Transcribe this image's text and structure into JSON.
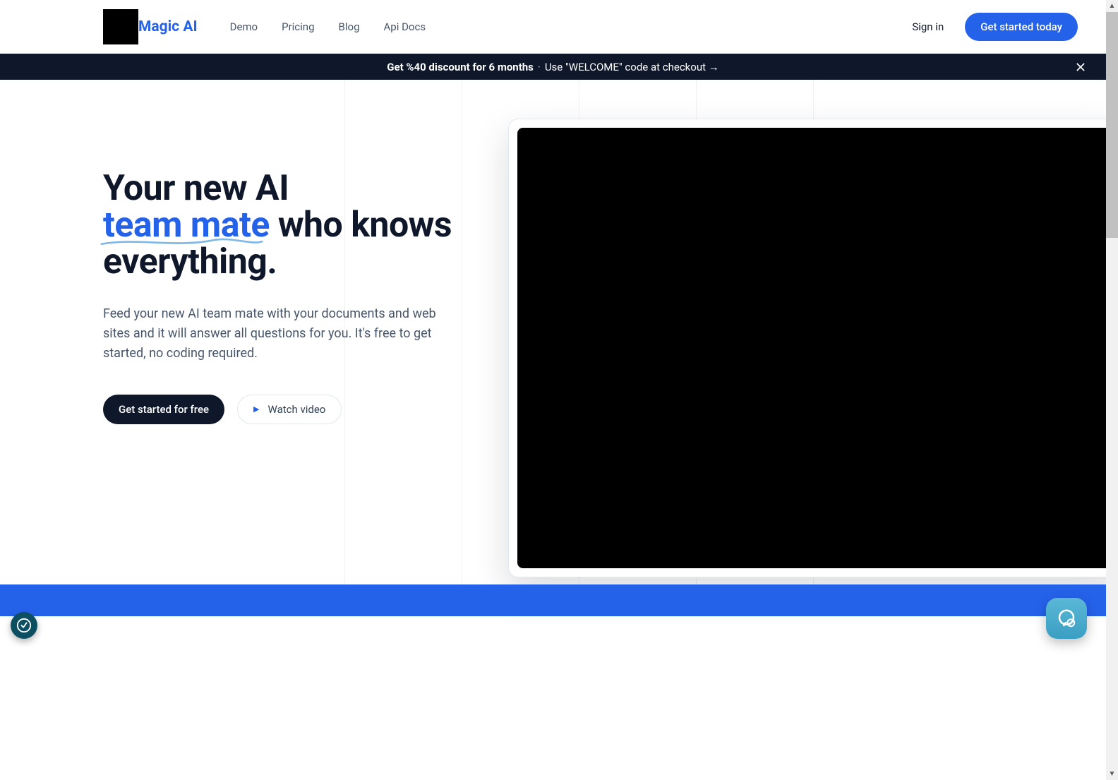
{
  "brand": "Magic AI",
  "nav": {
    "items": [
      "Demo",
      "Pricing",
      "Blog",
      "Api Docs"
    ],
    "signin": "Sign in",
    "cta": "Get started today"
  },
  "promo": {
    "bold": "Get %40 discount for 6 months",
    "sep": "·",
    "rest": "Use \"WELCOME\" code at checkout →"
  },
  "hero": {
    "headline_part1": "Your new AI",
    "headline_accent": "team mate",
    "headline_part2": " who knows everything.",
    "subtext": "Feed your new AI team mate with your documents and web sites and it will answer all questions for you. It's free to get started, no coding required.",
    "primary_btn": "Get started for free",
    "secondary_btn": "Watch video"
  },
  "colors": {
    "accent": "#2562ea",
    "dark": "#0f172a"
  }
}
